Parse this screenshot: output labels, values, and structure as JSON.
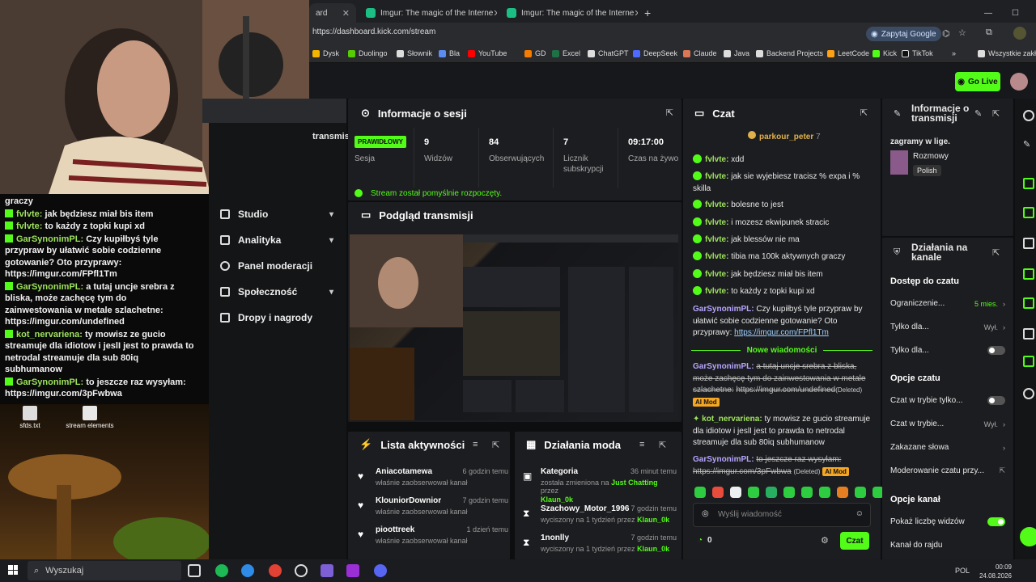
{
  "browser": {
    "tabs": [
      {
        "title": "ard"
      },
      {
        "title": "Imgur: The magic of the Interne"
      },
      {
        "title": "Imgur: The magic of the Interne"
      }
    ],
    "url": "https://dashboard.kick.com/stream",
    "google_btn": "Zapytaj Google",
    "bookmarks": [
      "Dysk",
      "Duolingo",
      "Słownik",
      "Bla",
      "YouTube",
      "GD",
      "Excel",
      "ChatGPT",
      "DeepSeek",
      "Claude",
      "Java",
      "Backend Projects",
      "LeetCode",
      "Kick",
      "TikTok",
      "»",
      "Wszystkie zakła"
    ]
  },
  "header": {
    "go_live": "Go Live"
  },
  "webcam_chat": [
    {
      "name": "",
      "text": "graczy"
    },
    {
      "name": "fvlvte:",
      "text": "jak będziesz miał bis item"
    },
    {
      "name": "fvlvte:",
      "text": "to każdy z topki kupi xd"
    },
    {
      "name": "GarSynonimPL:",
      "text": "Czy kupiłbyś tyle przypraw by ułatwić sobie codzienne gotowanie? Oto przyprawy: https://imgur.com/FPfl1Tm"
    },
    {
      "name": "GarSynonimPL:",
      "text": "a tutaj uncje srebra z bliska, może zachęcę tym do zainwestowania w metale szlachetne: https://imgur.com/undefined"
    },
    {
      "name": "kot_nervariena:",
      "text": "ty mowisz ze gucio streamuje dla idiotow i jeslI jest to prawda to netrodal streamuje dla sub 80iq subhumanow"
    },
    {
      "name": "GarSynonimPL:",
      "text": "to jeszcze raz wysyłam: https://imgur.com/3pFwbwa"
    }
  ],
  "desktop_icons": [
    "sfds.txt",
    "stream elements"
  ],
  "sidebar": {
    "partial_label": "transmis",
    "items": [
      {
        "label": "Studio",
        "chevron": "▾"
      },
      {
        "label": "Analityka",
        "chevron": "▾"
      },
      {
        "label": "Panel moderacji",
        "chevron": ""
      },
      {
        "label": "Społeczność",
        "chevron": "▾"
      },
      {
        "label": "Dropy i nagrody",
        "chevron": ""
      }
    ]
  },
  "session": {
    "title": "Informacje o sesji",
    "badge": "PRAWIDŁOWY",
    "badge_sub": "Sesja",
    "stats": [
      {
        "value": "9",
        "label": "Widzów"
      },
      {
        "value": "84",
        "label": "Obserwujących"
      },
      {
        "value": "7",
        "label": "Licznik subskrypcji"
      },
      {
        "value": "09:17:00",
        "label": "Czas na żywo"
      }
    ],
    "status": "Stream został pomyślnie rozpoczęty."
  },
  "preview": {
    "title": "Podgląd transmisji"
  },
  "activity": {
    "title": "Lista aktywności",
    "items": [
      {
        "name": "Aniacotamewa",
        "time": "6 godzin temu",
        "desc": "właśnie zaobserwował kanał"
      },
      {
        "name": "KlouniorDownior",
        "time": "7 godzin temu",
        "desc": "właśnie zaobserwował kanał"
      },
      {
        "name": "pioottreek",
        "time": "1 dzień temu",
        "desc": "właśnie zaobserwował kanał"
      }
    ]
  },
  "modactions": {
    "title": "Działania moda",
    "items": [
      {
        "name": "Kategoria",
        "time": "36 minut temu",
        "desc_pre": "została zmieniona na ",
        "desc_hl": "Just Chatting",
        "desc_mid": " przez ",
        "by": "Klaun_0k"
      },
      {
        "name": "Szachowy_Motor_1996",
        "time": "7 godzin temu",
        "desc_pre": "wyciszony na 1 tydzień przez ",
        "desc_hl": "",
        "desc_mid": "",
        "by": "Klaun_0k"
      },
      {
        "name": "1nonlly",
        "time": "7 godzin temu",
        "desc_pre": "wyciszony na 1 tydzień przez ",
        "desc_hl": "",
        "desc_mid": "",
        "by": "Klaun_0k"
      }
    ]
  },
  "chat": {
    "title": "Czat",
    "top_user": "parkour_peter",
    "top_count": "7",
    "messages": [
      {
        "name": "fvlvte:",
        "text": "xdd"
      },
      {
        "name": "fvlvte:",
        "text": "jak sie wyjebiesz tracisz % expa i % skilla"
      },
      {
        "name": "fvlvte:",
        "text": "bolesne to jest"
      },
      {
        "name": "fvlvte:",
        "text": "i mozesz ekwipunek stracic"
      },
      {
        "name": "fvlvte:",
        "text": "jak blessów nie ma"
      },
      {
        "name": "fvlvte:",
        "text": "tibia ma 100k aktywnych graczy"
      },
      {
        "name": "fvlvte:",
        "text": "jak będziesz miał bis item"
      },
      {
        "name": "fvlvte:",
        "text": "to każdy z topki kupi xd"
      }
    ],
    "gar1_name": "GarSynonimPL:",
    "gar1_text": "Czy kupiłbyś tyle przypraw by ułatwić sobie codzienne gotowanie? Oto przyprawy:",
    "gar1_link": "https://imgur.com/FPfl1Tm",
    "new_messages": "Nowe wiadomości",
    "gar2_name": "GarSynonimPL:",
    "gar2_text": "a tutaj uncje srebra z bliska, może zachęcę tym do zainwestowania w metale szlachetne:",
    "gar2_link": "https://imgur.com/undefined",
    "deleted": "(Deleted)",
    "ai_mod": "AI Mod",
    "kot_name": "kot_nervariena:",
    "kot_text": "ty mowisz ze gucio streamuje dla idiotow i jeslI jest to prawda to netrodal streamuje dla sub 80iq subhumanow",
    "gar3_name": "GarSynonimPL:",
    "gar3_text": "to jeszcze raz wysyłam:",
    "gar3_link": "https://imgur.com/3pFwbwa",
    "input_placeholder": "Wyślij wiadomość",
    "points": "0",
    "send": "Czat",
    "emote_colors": [
      "#2ecc40",
      "#e74c3c",
      "#ecf0f1",
      "#2ecc40",
      "#27ae60",
      "#2ecc40",
      "#2ecc40",
      "#2ecc40",
      "#e67e22",
      "#2ecc40",
      "#2ecc40"
    ]
  },
  "stream_info": {
    "title": "Informacje o transmisji",
    "desc": "zagramy w lige.",
    "category": "Rozmowy",
    "language": "Polish"
  },
  "channel_actions": {
    "title": "Działania na kanale",
    "chat_access": "Dostęp do czatu",
    "restriction_label": "Ograniczenie...",
    "restriction_val": "5 mies.",
    "chat_for_label": "Tylko dla...",
    "chat_for_val": "Wył.",
    "chat_for2_label": "Tylko dla...",
    "chat_options": "Opcje czatu",
    "slow_mode": "Czat w trybie tylko...",
    "mode2_label": "Czat w trybie...",
    "mode2_val": "Wył.",
    "banned_words": "Zakazane słowa",
    "moderation": "Moderowanie czatu przy...",
    "channel_options": "Opcje kanał",
    "show_viewers": "Pokaż liczbę widzów",
    "raid": "Kanał do rajdu"
  },
  "taskbar": {
    "search": "Wyszukaj",
    "lang": "POL",
    "time": "00:09",
    "date": "24.08.2026"
  }
}
